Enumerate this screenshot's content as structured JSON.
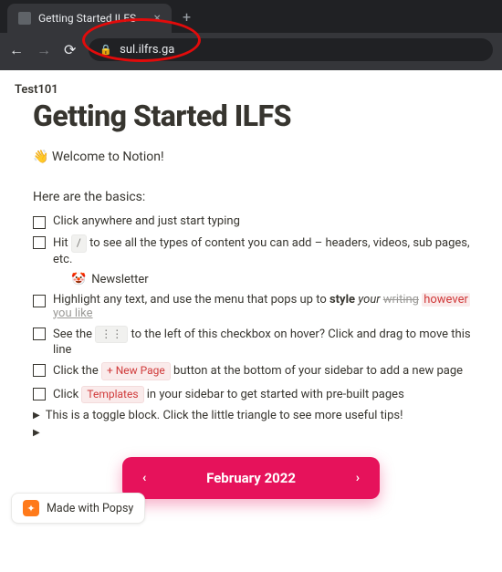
{
  "browser": {
    "tab_title": "Getting Started ILFS",
    "url": "sul.ilfrs.ga"
  },
  "ellipse_color": "#e20b0b",
  "page": {
    "crumb": "Test101",
    "title": "Getting Started ILFS",
    "welcome_emoji": "👋",
    "welcome_text": " Welcome to Notion!",
    "basics_intro": "Here are the basics:",
    "todos": {
      "t0": "Click anywhere and just start typing",
      "t1_a": "Hit ",
      "t1_key": "/",
      "t1_b": " to see all the types of content you can add – headers, videos, sub pages, etc.",
      "newsletter_emoji": "🤡",
      "newsletter_label": "Newsletter",
      "t2_a": "Highlight any text, and use the menu that pops up to ",
      "t2_style": "style",
      "t2_your": " your ",
      "t2_writing": "writing",
      "t2_however": "however",
      "t2_like": "you like",
      "t3_a": "See the ",
      "t3_handle": "⋮⋮",
      "t3_b": " to the left of this checkbox on hover? Click and drag to move this line",
      "t4_a": "Click the ",
      "t4_btn": "+ New Page",
      "t4_b": " button at the bottom of your sidebar to add a new page",
      "t5_a": "Click ",
      "t5_btn": "Templates",
      "t5_b": " in your sidebar to get started with pre-built pages"
    },
    "toggle1": "This is a toggle block. Click the little triangle to see more useful tips!",
    "month": {
      "label": "February 2022",
      "prev": "‹",
      "next": "›"
    },
    "popsy": {
      "icon": "✦",
      "label": "Made with Popsy"
    }
  }
}
